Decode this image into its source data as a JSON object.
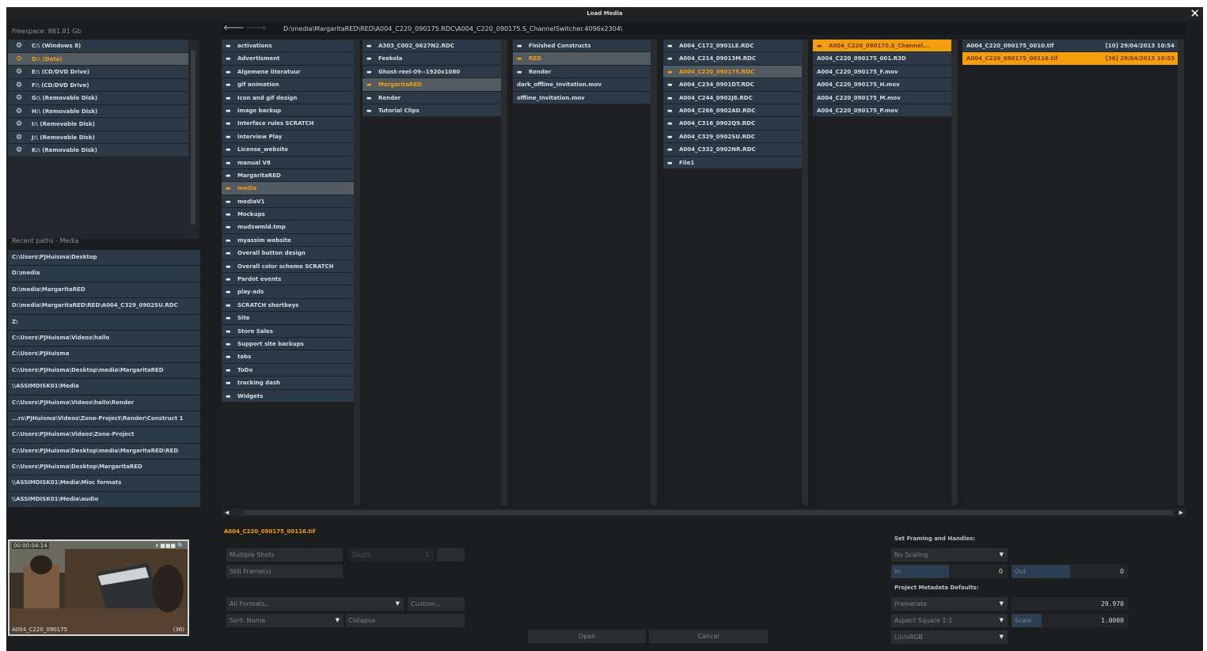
{
  "window": {
    "title": "Load Media"
  },
  "freespace": "Freespace: 881.81 Gb",
  "drives": [
    {
      "label": "C:\\ (Windows 8)",
      "selected": false
    },
    {
      "label": "D:\\ (Data)",
      "selected": true
    },
    {
      "label": "E:\\ (CD/DVD Drive)",
      "selected": false
    },
    {
      "label": "F:\\ (CD/DVD Drive)",
      "selected": false
    },
    {
      "label": "G:\\ (Removable Disk)",
      "selected": false
    },
    {
      "label": "H:\\ (Removable Disk)",
      "selected": false
    },
    {
      "label": "I:\\ (Removable Disk)",
      "selected": false
    },
    {
      "label": "J:\\ (Removable Disk)",
      "selected": false
    },
    {
      "label": "K:\\ (Removable Disk)",
      "selected": false
    }
  ],
  "recent": {
    "heading": "Recent paths - Media",
    "items": [
      "C:\\Users\\PJHuisma\\Desktop",
      "D:\\media",
      "D:\\media\\MargaritaRED",
      "D:\\media\\MargaritaRED\\RED\\A004_C329_0902SU.RDC",
      "Z:",
      "C:\\Users\\PJHuisma\\Videos\\hallo",
      "C:\\Users\\PJHuisma",
      "C:\\Users\\PJHuisma\\Desktop\\media\\MargaritaRED",
      "\\\\ASSIMDISK01\\Media",
      "C:\\Users\\PJHuisma\\Videos\\hallo\\Render",
      "...rs\\PJHuisma\\Videos\\Zone-Project\\Render\\Construct 1",
      "C:\\Users\\PJHuisma\\Videos\\Zone-Project",
      "C:\\Users\\PJHuisma\\Desktop\\media\\MargaritaRED\\RED",
      "C:\\Users\\PJHuisma\\Desktop\\MargaritaRED",
      "\\\\ASSIMDISK01\\Media\\Misc formats",
      "\\\\ASSIMDISK01\\Media\\audio"
    ]
  },
  "path": {
    "back_icon": "arrow-left-icon",
    "forward_icon": "arrow-right-icon",
    "current": "D:\\media\\MargaritaRED\\RED\\A004_C220_090175.RDC\\A004_C220_090175.S_ChannelSwitcher.4096x2304\\"
  },
  "columns": [
    [
      {
        "name": "activations",
        "folder": true
      },
      {
        "name": "Advertisment",
        "folder": true
      },
      {
        "name": "Algemene literatuur",
        "folder": true
      },
      {
        "name": "gif animation",
        "folder": true
      },
      {
        "name": "Icon and gif design",
        "folder": true
      },
      {
        "name": "image backup",
        "folder": true
      },
      {
        "name": "Interface rules SCRATCH",
        "folder": true
      },
      {
        "name": "interview Play",
        "folder": true
      },
      {
        "name": "License_website",
        "folder": true
      },
      {
        "name": "manual V8",
        "folder": true
      },
      {
        "name": "MargaritaRED",
        "folder": true
      },
      {
        "name": "media",
        "folder": true,
        "selected": true
      },
      {
        "name": "mediaV1",
        "folder": true
      },
      {
        "name": "Mockups",
        "folder": true
      },
      {
        "name": "mudswmld.tmp",
        "folder": true
      },
      {
        "name": "myassim website",
        "folder": true
      },
      {
        "name": "Overall button design",
        "folder": true
      },
      {
        "name": "Overall color scheme SCRATCH",
        "folder": true
      },
      {
        "name": "Pardot events",
        "folder": true
      },
      {
        "name": "play-ads",
        "folder": true
      },
      {
        "name": "SCRATCH shortkeys",
        "folder": true
      },
      {
        "name": "Site",
        "folder": true
      },
      {
        "name": "Store Sales",
        "folder": true
      },
      {
        "name": "Support site backups",
        "folder": true
      },
      {
        "name": "tabs",
        "folder": true
      },
      {
        "name": "ToDo",
        "folder": true
      },
      {
        "name": "tracking dash",
        "folder": true
      },
      {
        "name": "Widgets",
        "folder": true
      }
    ],
    [
      {
        "name": "A303_C002_0627N2.RDC",
        "folder": true
      },
      {
        "name": "Feekola",
        "folder": true
      },
      {
        "name": "Ghost-reel-09--1920x1080",
        "folder": true
      },
      {
        "name": "MargaritaRED",
        "folder": true,
        "selected": true
      },
      {
        "name": "Render",
        "folder": true
      },
      {
        "name": "Tutorial Clips",
        "folder": true
      }
    ],
    [
      {
        "name": "Finished Constructs",
        "folder": true
      },
      {
        "name": "RED",
        "folder": true,
        "selected": true
      },
      {
        "name": "Render",
        "folder": true
      },
      {
        "name": "dark_offline_Invitation.mov",
        "folder": false
      },
      {
        "name": "offline_Invitation.mov",
        "folder": false
      }
    ],
    [
      {
        "name": "A004_C172_0901LE.RDC",
        "folder": true
      },
      {
        "name": "A004_C214_09013M.RDC",
        "folder": true
      },
      {
        "name": "A004_C220_090175.RDC",
        "folder": true,
        "selected": true
      },
      {
        "name": "A004_C234_0901DT.RDC",
        "folder": true
      },
      {
        "name": "A004_C244_0902J6.RDC",
        "folder": true
      },
      {
        "name": "A004_C266_0902AD.RDC",
        "folder": true
      },
      {
        "name": "A004_C316_0902Q9.RDC",
        "folder": true
      },
      {
        "name": "A004_C329_0902SU.RDC",
        "folder": true
      },
      {
        "name": "A004_C332_0902NR.RDC",
        "folder": true
      },
      {
        "name": "File1",
        "folder": true
      }
    ],
    [
      {
        "name": "A004_C220_090175.S_Channel...",
        "folder": true,
        "highlighted": true
      },
      {
        "name": "A004_C220_090175_001.R3D",
        "folder": false
      },
      {
        "name": "A004_C220_090175_F.mov",
        "folder": false
      },
      {
        "name": "A004_C220_090175_H.mov",
        "folder": false
      },
      {
        "name": "A004_C220_090175_M.mov",
        "folder": false
      },
      {
        "name": "A004_C220_090175_P.mov",
        "folder": false
      }
    ],
    [
      {
        "name": "A004_C220_090175_0010.tif",
        "date": "[10] 29/04/2013 10:54",
        "folder": false
      },
      {
        "name": "A004_C220_090175_00116.tif",
        "date": "[36] 29/04/2013 10:53",
        "folder": false,
        "highlighted": true
      }
    ]
  ],
  "selected_file": "A004_C220_090175_00116.tif",
  "options": {
    "multiple_shots": "Multiple Shots",
    "depth_label": "Depth",
    "depth_value": "1",
    "still_frames": "Still Frame(s)",
    "formats": "All Formats..",
    "custom": "Custom...",
    "sort": "Sort: Name",
    "collapse": "Collapse"
  },
  "buttons": {
    "open": "Open",
    "cancel": "Cancel"
  },
  "framing": {
    "heading": "Set Framing and Handles:",
    "scaling": "No Scaling",
    "in_label": "In",
    "in_value": "0",
    "out_label": "Out",
    "out_value": "0"
  },
  "metadata": {
    "heading": "Project Metadata Defaults:",
    "framerate_label": "Framerate",
    "framerate_value": "29.970",
    "aspect": "Aspect Square 1:1",
    "scale_label": "Scale",
    "scale_value": "1.0000",
    "colorspace": "Lin/sRGB"
  },
  "preview": {
    "timecode": "00:00:04:14",
    "clip_name": "A004_C220_090175",
    "frame_count": "(36)"
  },
  "colors": {
    "accent": "#f59e0b",
    "item_bg": "#2c3a47",
    "selected_bg": "#525a62"
  }
}
